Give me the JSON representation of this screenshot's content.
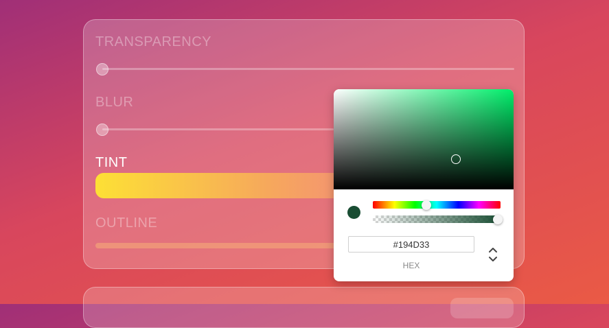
{
  "settings": {
    "transparency": {
      "label": "TRANSPARENCY",
      "value": 0
    },
    "blur": {
      "label": "BLUR",
      "value": 0
    },
    "tint": {
      "label": "TINT",
      "color_start": "#fde035",
      "color_end": "#f38a7c"
    },
    "outline": {
      "label": "OUTLINE"
    }
  },
  "color_picker": {
    "hex_value": "#194D33",
    "mode_label": "HEX",
    "hue_color": "#00ee6a",
    "selected_color": "#194d33",
    "hue_fraction": 0.42,
    "alpha_fraction": 1.0,
    "saturation": 0.68,
    "brightness": 0.3,
    "mode_toggle_icon": "up-down-chevron-icon"
  },
  "colors": {
    "background_start": "#a02f77",
    "background_end": "#ea5a45"
  }
}
